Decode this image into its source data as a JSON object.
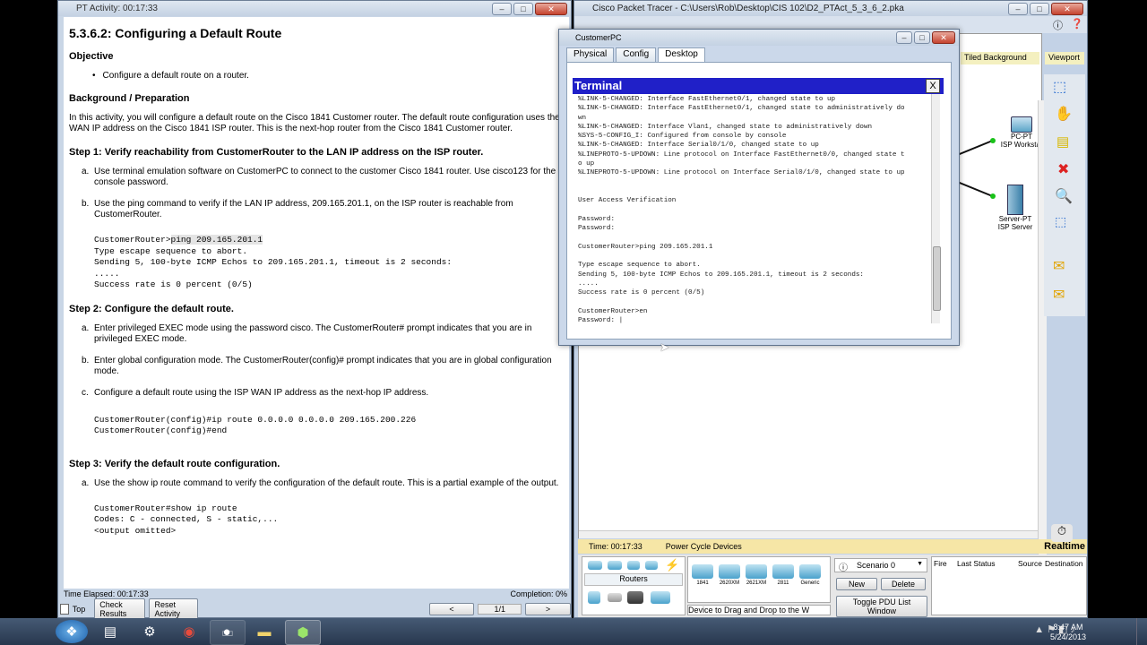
{
  "activity": {
    "window_title": "PT Activity: 00:17:33",
    "heading": "5.3.6.2: Configuring a Default Route",
    "objective_h": "Objective",
    "objective_item": "Configure a default route on a router.",
    "bg_h": "Background / Preparation",
    "bg_text": "In this activity, you will configure a default route on the Cisco 1841 Customer router. The default route configuration uses the WAN IP address on the Cisco 1841 ISP router. This is the next-hop router from the Cisco 1841 Customer router.",
    "step1_h": "Step 1: Verify reachability from CustomerRouter to the LAN IP address on the ISP router.",
    "step1_a": "Use terminal emulation software on CustomerPC to connect to the customer Cisco 1841 router. Use cisco123 for the console password.",
    "step1_b": "Use the ping command to verify if the LAN IP address, 209.165.201.1, on the ISP router is reachable from CustomerRouter.",
    "code1_prompt": "CustomerRouter>",
    "code1_cmd": "ping 209.165.201.1",
    "code1_out": "Type escape sequence to abort.\nSending 5, 100-byte ICMP Echos to 209.165.201.1, timeout is 2 seconds:\n.....\nSuccess rate is 0 percent (0/5)",
    "step2_h": "Step 2: Configure the default route.",
    "step2_a": "Enter privileged EXEC mode using the password cisco. The CustomerRouter# prompt indicates that you are in privileged EXEC mode.",
    "step2_b": "Enter global configuration mode. The CustomerRouter(config)# prompt indicates that you are in global configuration mode.",
    "step2_c": "Configure a default route using the ISP WAN IP address as the next-hop IP address.",
    "code2_l1_prompt": "CustomerRouter(config)#",
    "code2_l1_cmd": "ip route 0.0.0.0 0.0.0.0 209.165.200.226",
    "code2_l2_prompt": "CustomerRouter(config)#",
    "code2_l2_cmd": "end",
    "step3_h": "Step 3: Verify the default route configuration.",
    "step3_a": "Use the show ip route command to verify the configuration of the default route. This is a partial example of the output.",
    "code3_prompt": "CustomerRouter#",
    "code3_cmd": "show ip route",
    "code3_l2": "Codes: C - connected, S - static,...",
    "code3_l3": "<output omitted>",
    "time_elapsed": "Time Elapsed: 00:17:33",
    "completion": "Completion: 0%",
    "top_label": "Top",
    "check_results": "Check Results",
    "reset_activity": "Reset Activity",
    "prev": "<",
    "page": "1/1",
    "next": ">"
  },
  "pt": {
    "window_title": "Cisco Packet Tracer - C:\\Users\\Rob\\Desktop\\CIS 102\\D2_PTAct_5_3_6_2.pka",
    "tiled_bg": "Tiled Background",
    "viewport": "Viewport",
    "pc_label1": "PC-PT",
    "pc_label2": "ISP Workstat",
    "srv_label1": "Server-PT",
    "srv_label2": "ISP Server",
    "time": "Time: 00:17:33",
    "power_cycle": "Power Cycle Devices",
    "realtime": "Realtime",
    "routers": "Routers",
    "dev_models": [
      "1841",
      "2620XM",
      "2621XM",
      "2811",
      "Generic"
    ],
    "drag_hint": "Device to Drag and Drop to the W",
    "scenario": "Scenario 0",
    "new": "New",
    "delete": "Delete",
    "toggle_pdu": "Toggle PDU List Window",
    "cols": [
      "Fire",
      "Last Status",
      "Source",
      "Destination"
    ]
  },
  "customerpc": {
    "window_title": "CustomerPC",
    "tabs": [
      "Physical",
      "Config",
      "Desktop"
    ],
    "terminal_title": "Terminal",
    "close": "X",
    "output": "%LINK-5-CHANGED: Interface FastEthernet0/1, changed state to up\n%LINK-5-CHANGED: Interface FastEthernet0/1, changed state to administratively do\nwn\n%LINK-5-CHANGED: Interface Vlan1, changed state to administratively down\n%SYS-5-CONFIG_I: Configured from console by console\n%LINK-5-CHANGED: Interface Serial0/1/0, changed state to up\n%LINEPROTO-5-UPDOWN: Line protocol on Interface FastEthernet0/0, changed state t\no up\n%LINEPROTO-5-UPDOWN: Line protocol on Interface Serial0/1/0, changed state to up\n\n\nUser Access Verification\n\nPassword:\nPassword:\n\nCustomerRouter>ping 209.165.201.1\n\nType escape sequence to abort.\nSending 5, 100-byte ICMP Echos to 209.165.201.1, timeout is 2 seconds:\n.....\nSuccess rate is 0 percent (0/5)\n\nCustomerRouter>en\nPassword: |"
  },
  "taskbar": {
    "time": "8:47 AM",
    "date": "5/24/2013"
  }
}
